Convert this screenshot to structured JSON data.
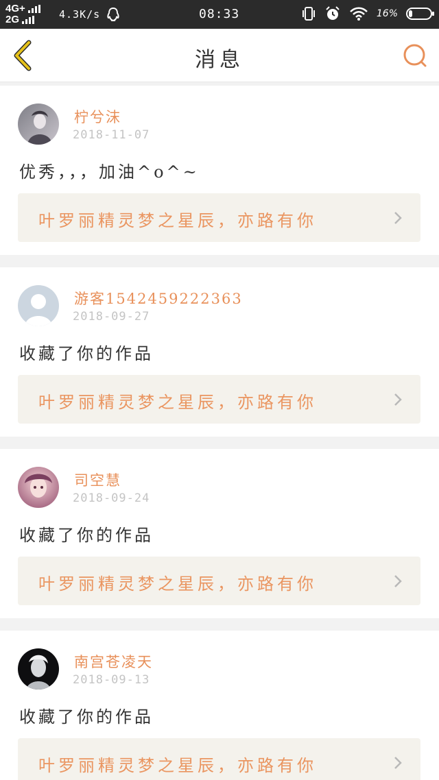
{
  "status_bar": {
    "network_top": "4G+",
    "network_bottom": "2G",
    "speed": "4.3K/s",
    "time": "08:33",
    "battery": "16%",
    "battery_level": 0.16
  },
  "header": {
    "title": "消息"
  },
  "notifications": [
    {
      "username": "柠兮沫",
      "date": "2018-11-07",
      "message": "优秀，，，加油^o^~",
      "work_title": "叶罗丽精灵梦之星辰，亦路有你"
    },
    {
      "username": "游客1542459222363",
      "date": "2018-09-27",
      "message": "收藏了你的作品",
      "work_title": "叶罗丽精灵梦之星辰，亦路有你"
    },
    {
      "username": "司空慧",
      "date": "2018-09-24",
      "message": "收藏了你的作品",
      "work_title": "叶罗丽精灵梦之星辰，亦路有你"
    },
    {
      "username": "南宫苍凌天",
      "date": "2018-09-13",
      "message": "收藏了你的作品",
      "work_title": "叶罗丽精灵梦之星辰，亦路有你"
    }
  ],
  "colors": {
    "accent": "#e8905a",
    "back_arrow": "#e6c21a",
    "link_bg": "#f4f2ec"
  }
}
